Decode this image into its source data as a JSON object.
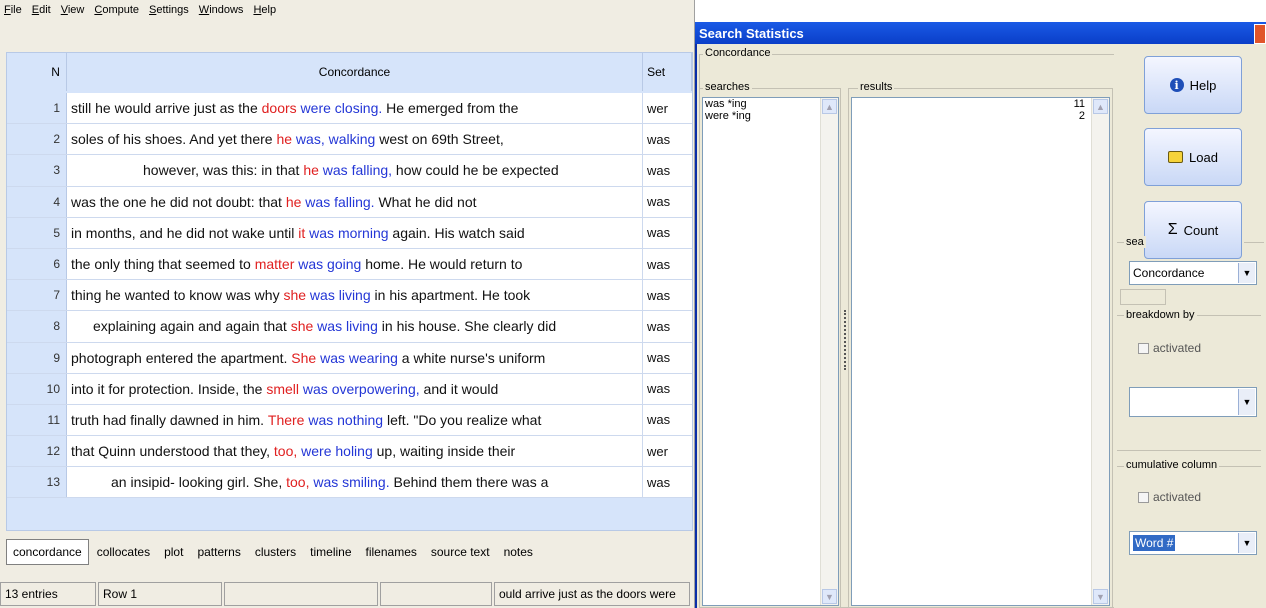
{
  "menu": [
    {
      "acc": "F",
      "rest": "ile"
    },
    {
      "acc": "E",
      "rest": "dit"
    },
    {
      "acc": "V",
      "rest": "iew"
    },
    {
      "acc": "C",
      "rest": "ompute"
    },
    {
      "acc": "S",
      "rest": "ettings"
    },
    {
      "acc": "W",
      "rest": "indows"
    },
    {
      "acc": "H",
      "rest": "elp"
    }
  ],
  "table": {
    "headers": {
      "n": "N",
      "concordance": "Concordance",
      "set": "Set"
    },
    "rows": [
      {
        "n": "1",
        "pre": "still he would arrive just as the ",
        "red": "doors",
        "blue": " were closing.",
        "post": " He emerged from the",
        "set": "wer",
        "indent": 0
      },
      {
        "n": "2",
        "pre": "soles of his shoes. And yet there ",
        "red": "he",
        "blue": " was, walking",
        "post": " west on 69th Street,",
        "set": "was",
        "indent": 0
      },
      {
        "n": "3",
        "pre": "however, was this: in that ",
        "red": "he",
        "blue": " was falling,",
        "post": " how could he be expected",
        "set": "was",
        "indent": 72
      },
      {
        "n": "4",
        "pre": "was the one he did not doubt: that ",
        "red": "he",
        "blue": " was falling.",
        "post": " What he did not",
        "set": "was",
        "indent": 0
      },
      {
        "n": "5",
        "pre": "in months, and he did not wake until ",
        "red": "it",
        "blue": " was morning",
        "post": " again. His watch said",
        "set": "was",
        "indent": 0
      },
      {
        "n": "6",
        "pre": "the only thing that seemed to ",
        "red": "matter",
        "blue": " was going",
        "post": " home. He would return to",
        "set": "was",
        "indent": 0
      },
      {
        "n": "7",
        "pre": "thing he wanted to know was why ",
        "red": "she",
        "blue": " was living",
        "post": " in his apartment. He took",
        "set": "was",
        "indent": 0
      },
      {
        "n": "8",
        "pre": "explaining again and again that ",
        "red": "she",
        "blue": " was living",
        "post": " in his house. She clearly did",
        "set": "was",
        "indent": 22
      },
      {
        "n": "9",
        "pre": "photograph entered the apartment. ",
        "red": "She",
        "blue": " was wearing",
        "post": " a white nurse's uniform",
        "set": "was",
        "indent": 0
      },
      {
        "n": "10",
        "pre": "into it for protection. Inside, the ",
        "red": "smell",
        "blue": " was overpowering,",
        "post": " and it would",
        "set": "was",
        "indent": 0
      },
      {
        "n": "11",
        "pre": "truth had finally dawned in him. ",
        "red": "There",
        "blue": " was nothing",
        "post": " left. \"Do you realize what",
        "set": "was",
        "indent": 0
      },
      {
        "n": "12",
        "pre": "that Quinn understood that they, ",
        "red": "too,",
        "blue": " were holing",
        "post": " up, waiting inside their",
        "set": "wer",
        "indent": 0
      },
      {
        "n": "13",
        "pre": "an insipid- looking girl. She, ",
        "red": "too,",
        "blue": " was smiling.",
        "post": " Behind them there was a",
        "set": "was",
        "indent": 40
      }
    ]
  },
  "tabs": [
    "concordance",
    "collocates",
    "plot",
    "patterns",
    "clusters",
    "timeline",
    "filenames",
    "source text",
    "notes"
  ],
  "active_tab": "concordance",
  "status": {
    "entries": "13 entries",
    "row": "Row 1",
    "empty1": "",
    "empty2": "",
    "preview": "ould arrive just as the doors were"
  },
  "dialog": {
    "title": "Search Statistics",
    "group_label": "Concordance",
    "searches_label": "searches",
    "results_label": "results",
    "searches": [
      "was *ing",
      "were *ing"
    ],
    "results": [
      "11",
      "2"
    ],
    "help_label": "Help",
    "load_label": "Load",
    "count_label": "Count",
    "sea_label": "sea",
    "search_select_value": "Concordance",
    "breakdown_label": "breakdown by",
    "activated_label": "activated",
    "breakdown_select_value": "",
    "cumulative_label": "cumulative column",
    "cumulative_activated_label": "activated",
    "cumulative_select_value": "Word #"
  },
  "colors": {
    "keyword_red": "#e02020",
    "keyword_blue": "#2336d6",
    "title_blue": "#0a3ec8"
  }
}
